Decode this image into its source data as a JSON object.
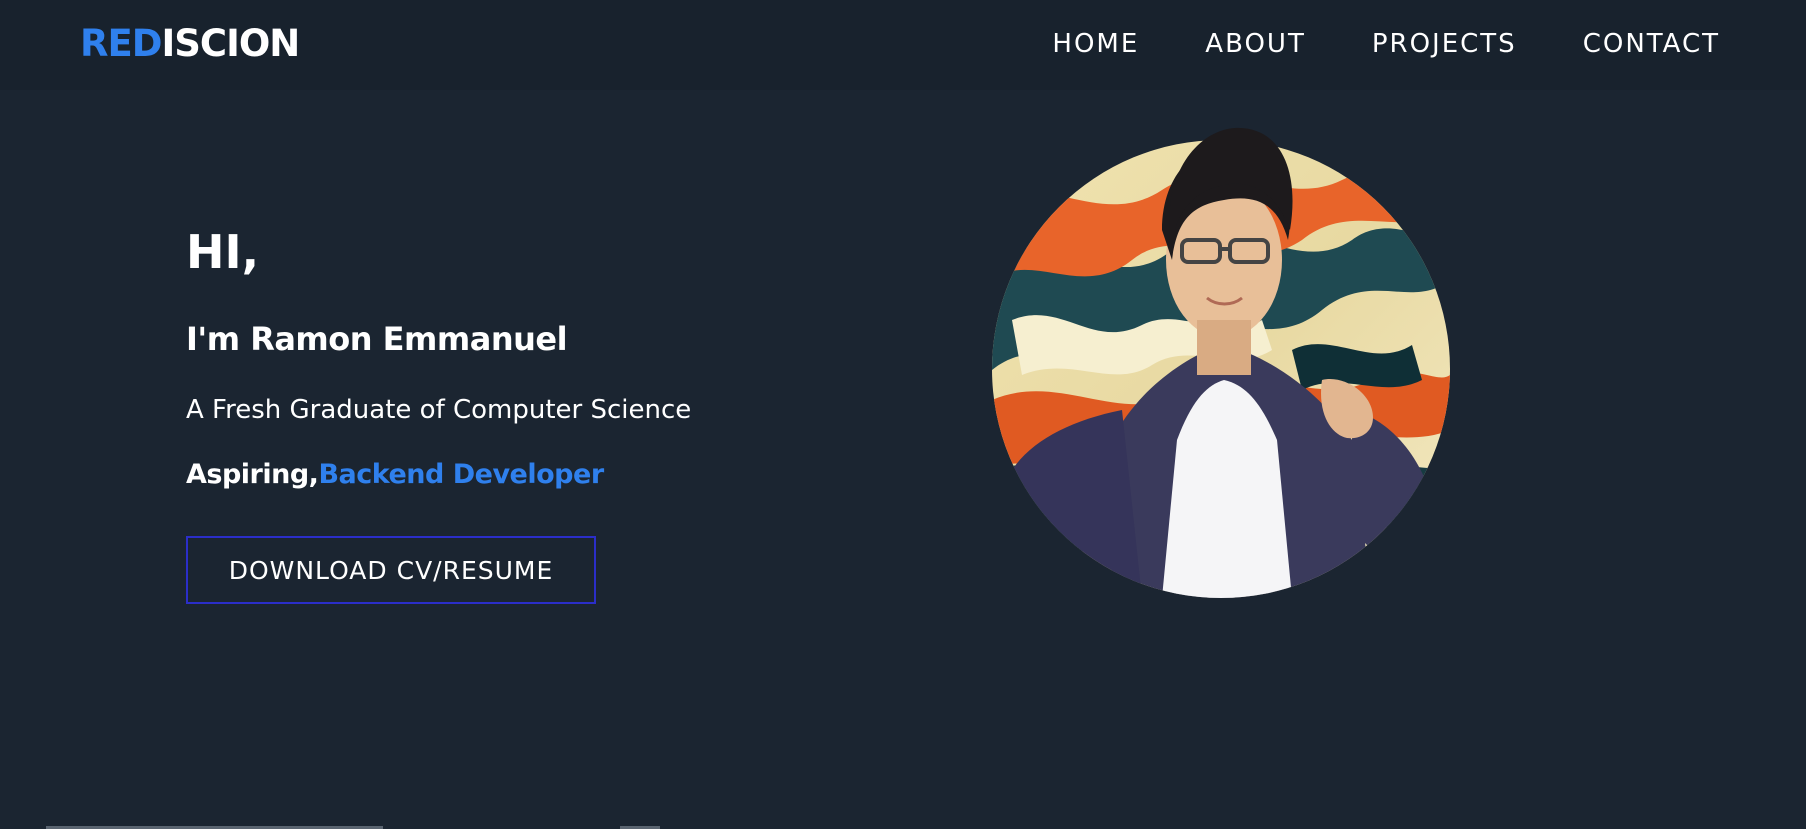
{
  "header": {
    "logo": {
      "part1": "R",
      "part2": "ED",
      "part3": "ISCION"
    },
    "nav": [
      {
        "label": "HOME"
      },
      {
        "label": "ABOUT"
      },
      {
        "label": "PROJECTS"
      },
      {
        "label": "CONTACT"
      }
    ]
  },
  "hero": {
    "greeting": "HI,",
    "name": "I'm Ramon Emmanuel",
    "subtitle": "A Fresh Graduate of Computer Science",
    "aspiring_prefix": "Aspiring,",
    "aspiring_role": "Backend Developer",
    "cv_button": "DOWNLOAD CV/RESUME"
  },
  "colors": {
    "background": "#1b2531",
    "accent": "#2f80ed",
    "button_border": "#2b2ec9"
  }
}
